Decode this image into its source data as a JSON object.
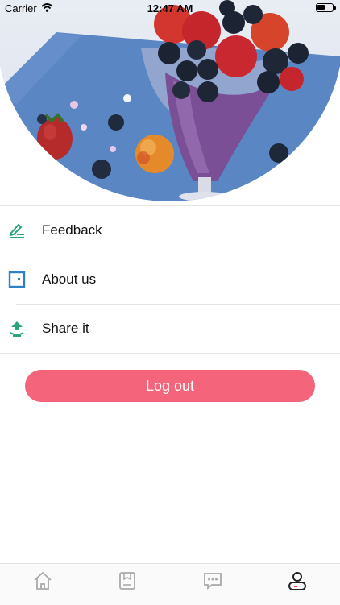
{
  "status_bar": {
    "carrier": "Carrier",
    "time": "12:47 AM",
    "icons": [
      "wifi-icon",
      "battery-icon"
    ]
  },
  "menu": {
    "items": [
      {
        "label": "Feedback",
        "icon": "edit-icon",
        "color": "#2aa57a"
      },
      {
        "label": "About us",
        "icon": "frame-icon",
        "color": "#2f7fc7"
      },
      {
        "label": "Share it",
        "icon": "share-upload-icon",
        "color": "#2aa57a"
      }
    ]
  },
  "logout": {
    "label": "Log out",
    "color": "#f4647a"
  },
  "tabbar": {
    "tabs": [
      {
        "icon": "home-icon",
        "active": false
      },
      {
        "icon": "bookmark-icon",
        "active": false
      },
      {
        "icon": "message-icon",
        "active": false
      },
      {
        "icon": "profile-icon",
        "active": true
      }
    ],
    "inactive_color": "#a9a9a9",
    "active_color": "#222222"
  }
}
